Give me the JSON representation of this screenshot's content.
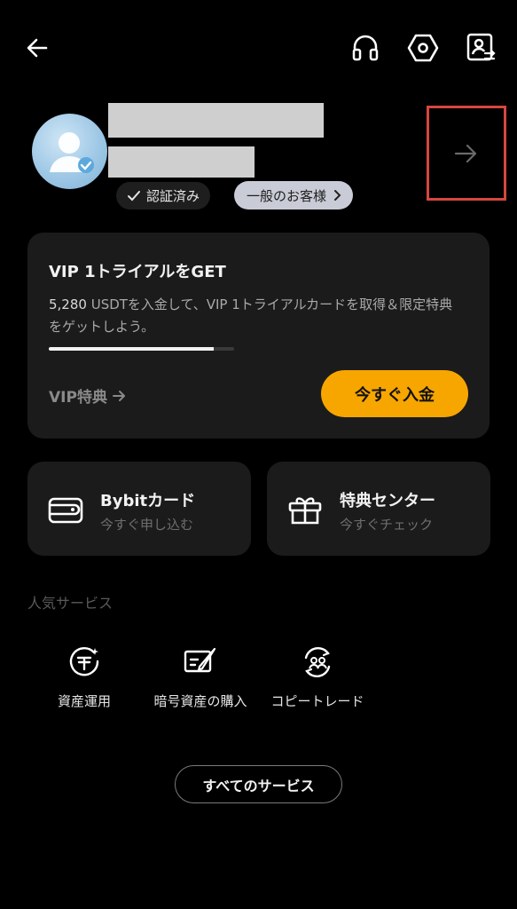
{
  "header": {
    "back_icon": "back-arrow-icon",
    "icons": [
      "headset-icon",
      "settings-hex-icon",
      "profile-switch-icon"
    ]
  },
  "profile": {
    "verified_label": "認証済み",
    "customer_type_label": "一般のお客様",
    "arrow_icon": "arrow-right-icon",
    "accent_color": "#d6473f"
  },
  "vip": {
    "title": "VIP 1トライアルをGET",
    "desc_amount": "5,280",
    "desc_text": " USDTを入金して、VIP 1トライアルカードを取得＆限定特典をゲットしよう。",
    "progress_fraction": 0.0,
    "progress_display_fraction": 0.89,
    "benefits_link": "VIP特典",
    "deposit_button": "今すぐ入金",
    "deposit_color": "#f7a600"
  },
  "cards": [
    {
      "title": "Bybitカード",
      "subtitle": "今すぐ申し込む",
      "icon": "wallet-icon"
    },
    {
      "title": "特典センター",
      "subtitle": "今すぐチェック",
      "icon": "gift-icon"
    }
  ],
  "popular": {
    "title": "人気サービス",
    "items": [
      {
        "label": "資産運用",
        "icon": "tether-earn-icon"
      },
      {
        "label": "暗号資産の購入",
        "icon": "buy-crypto-icon"
      },
      {
        "label": "コピートレード",
        "icon": "copy-trade-icon"
      }
    ],
    "all_button": "すべてのサービス"
  }
}
